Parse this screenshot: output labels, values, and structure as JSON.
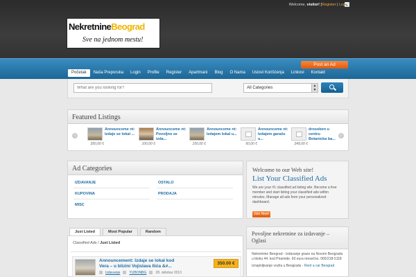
{
  "topbar": {
    "welcome": "Welcome, ",
    "user": "visitor!",
    "sep1": " [",
    "register": "Register",
    "sep2": " | ",
    "login": "Login",
    "sep3": "]"
  },
  "logo": {
    "word1": "Nekretnine",
    "word2": "Beograd",
    "slogan": "Sve na jednom mestu!"
  },
  "post_ad_label": "Post an Ad",
  "nav": [
    "Početak",
    "Naša Preporuka",
    "Login",
    "Profile",
    "Register",
    "Apartmani",
    "Blog",
    "O Nama",
    "Uslovi Korišćenja",
    "Linkovi",
    "Kontakt"
  ],
  "search": {
    "placeholder": "What are you looking for?",
    "category": "All Categories"
  },
  "featured": {
    "title": "Featured Listings",
    "items": [
      {
        "title": "Announceme nt: Izdaje se lokal ...",
        "price": "350,00 €"
      },
      {
        "title": "Announceme nt: Povoljno se izda...",
        "price": "100,00 €"
      },
      {
        "title": "Announceme nt: Izdajem lokal u...",
        "price": "150,00 €"
      },
      {
        "title": "Announceme nt: Izdajem garažu u...",
        "price": "60,00 €"
      },
      {
        "title": "drosoben u centru Botanicka ba...",
        "price": "249,00 €"
      }
    ]
  },
  "ad_categories": {
    "title": "Ad Categories",
    "left": [
      "IZDAVANJE",
      "KUPOVINA",
      "MISC"
    ],
    "right": [
      "OSTALO",
      "PRODAJA"
    ]
  },
  "welcome": {
    "head": "Welcome to our Web site!",
    "title": "List Your Classified Ads",
    "text": "We are your #1 classified ad listing site. Become a free member and start listing your classified ads within minutes. Manage all ads from your personalized dashboard.",
    "join": "Join Now!"
  },
  "tabs": [
    "Just Listed",
    "Most Popular",
    "Random"
  ],
  "breadcrumb": {
    "root": "Classified Ads",
    "sep": " / ",
    "current": "Just Listed"
  },
  "listing": {
    "title": "Announcement: Izdaje se lokal kod Vera – u blizini Vojislava Ilića &#...",
    "price": "350.00 €",
    "category": "Izdavanje",
    "author": "YUBONBG",
    "date": "28. oktobar 2013"
  },
  "sidebar2": {
    "title": "Povoljne nekretnine za izdavanje – Oglasi",
    "text": "Nekretnine Beograd - Izdavanje graze na Novom Beogradu u bloku 44. kod Piramide. 60 eura mesečno. 065/218-5118",
    "text2a": "Iznajmljivanje vozila u Beogradu - ",
    "text2b": "Rent a car Beograd"
  }
}
